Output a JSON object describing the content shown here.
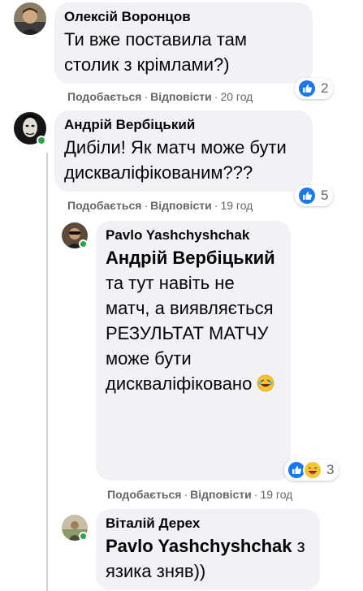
{
  "comments": [
    {
      "author": "Олексій Воронцов",
      "text": "Ти вже поставила там столик з крімлами?)",
      "actions": {
        "like": "Подобається",
        "reply": "Відповісти",
        "time": "20 год"
      },
      "reactions": {
        "icons": [
          "like-icon"
        ],
        "count": "2"
      }
    },
    {
      "author": "Андрій Вербіцький",
      "text": "Дибіли! Як матч може бути дискваліфікованим???",
      "actions": {
        "like": "Подобається",
        "reply": "Відповісти",
        "time": "19 год"
      },
      "reactions": {
        "icons": [
          "like-icon"
        ],
        "count": "5"
      }
    },
    {
      "author": "Pavlo Yashchyshchak",
      "mention": "Андрій Вербіцький",
      "text": "та тут навіть не матч, а виявляється РЕЗУЛЬТАТ МАТЧУ може бути дискваліфіковано",
      "emoji": "rolling-laughing-emoji",
      "actions": {
        "like": "Подобається",
        "reply": "Відповісти",
        "time": "19 год"
      },
      "reactions": {
        "icons": [
          "like-icon",
          "haha-icon"
        ],
        "count": "3"
      }
    },
    {
      "author": "Віталій Дерех",
      "mention": "Pavlo Yashchyshchak",
      "text": "з язика зняв))"
    }
  ],
  "colors": {
    "bubble": "#f0f2f5",
    "meta_text": "#65676b",
    "like_blue": "#1877f2",
    "online_green": "#31a24c"
  }
}
